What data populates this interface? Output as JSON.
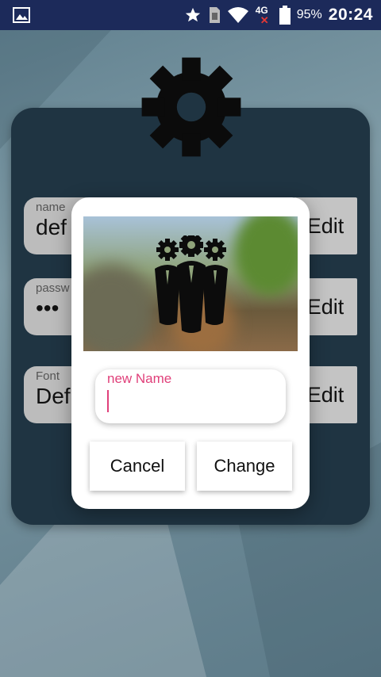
{
  "status_bar": {
    "gallery_icon": "image-icon",
    "star_icon": "star-icon",
    "sim_icon": "sim-card-icon",
    "wifi_icon": "wifi-icon",
    "network": "4G",
    "battery_icon": "battery-icon",
    "battery_percent": "95%",
    "time": "20:24"
  },
  "header": {
    "icon": "gear-icon"
  },
  "settings": {
    "name": {
      "label": "name",
      "value": "def",
      "edit_label": "Edit"
    },
    "password": {
      "label": "passw",
      "value": "•••",
      "edit_label": "Edit"
    },
    "font": {
      "label": "Font",
      "value": "Def",
      "edit_label": "Edit"
    }
  },
  "dialog": {
    "image_icon": "team-gears-icon",
    "input_label": "new Name",
    "input_value": "",
    "cancel_label": "Cancel",
    "change_label": "Change"
  },
  "colors": {
    "status_bar": "#1c2a5a",
    "card": "#1f3442",
    "accent": "#e0407a",
    "field": "#bcbcbc"
  }
}
